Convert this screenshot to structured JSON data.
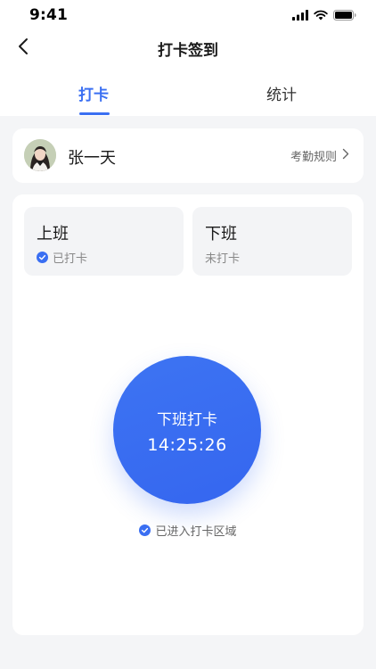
{
  "status_bar": {
    "time": "9:41",
    "icons": [
      "cellular-signal-icon",
      "wifi-icon",
      "battery-icon"
    ]
  },
  "nav": {
    "title": "打卡签到",
    "back_icon": "chevron-left-icon"
  },
  "tabs": [
    {
      "label": "打卡",
      "active": true
    },
    {
      "label": "统计",
      "active": false
    }
  ],
  "user": {
    "name": "张一天",
    "rules_label": "考勤规则",
    "rules_icon": "chevron-right-icon"
  },
  "shifts": {
    "on": {
      "title": "上班",
      "status": "已打卡",
      "checked": true
    },
    "off": {
      "title": "下班",
      "status": "未打卡",
      "checked": false
    }
  },
  "punch": {
    "label": "下班打卡",
    "time": "14:25:26"
  },
  "area_status": "已进入打卡区域",
  "colors": {
    "accent": "#3a6ff2",
    "background": "#f4f5f7",
    "card": "#ffffff",
    "shift_box": "#f3f4f6"
  }
}
